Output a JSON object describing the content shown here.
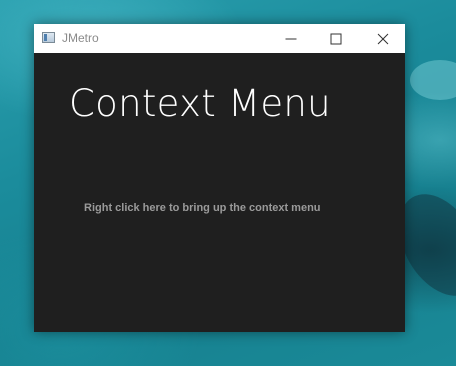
{
  "window": {
    "title": "JMetro",
    "minimize_icon": "minimize-icon",
    "maximize_icon": "maximize-icon",
    "close_icon": "close-icon",
    "app_icon": "app-window-icon"
  },
  "content": {
    "heading": "Context Menu",
    "context_hint": "Right click here to bring up the context menu"
  },
  "colors": {
    "content_background": "#1f1f1f",
    "titlebar_background": "#ffffff",
    "heading_text": "#ffffff",
    "hint_text": "#9a9a9a",
    "desktop_wallpaper": "#1b8c9c"
  }
}
